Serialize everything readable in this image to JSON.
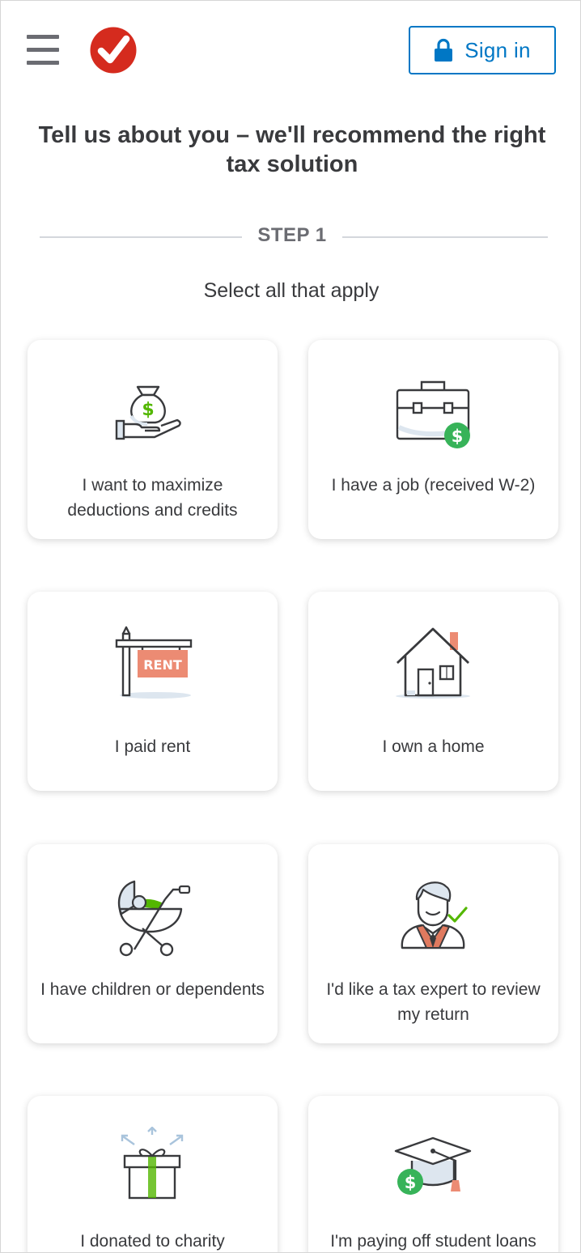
{
  "header": {
    "menu_icon": "hamburger-menu-icon",
    "logo_icon": "checkmark-logo-icon",
    "signin_icon": "lock-icon",
    "signin_label": "Sign in"
  },
  "headline": "Tell us about you – we'll recommend the right tax solution",
  "step_label": "STEP 1",
  "subhead": "Select all that apply",
  "colors": {
    "accent": "#0077c5",
    "logo_red": "#d52b1e",
    "icon_green": "#53b700",
    "rent_sign": "#ec8b73",
    "text": "#393a3d",
    "muted": "#6b6c72"
  },
  "options": [
    {
      "icon": "money-bag-hand-icon",
      "label": "I want to maximize deductions and credits"
    },
    {
      "icon": "briefcase-dollar-icon",
      "label": "I have a job (received W-2)"
    },
    {
      "icon": "rent-sign-icon",
      "rent_text": "RENT",
      "label": "I paid rent"
    },
    {
      "icon": "house-icon",
      "label": "I own a home"
    },
    {
      "icon": "baby-stroller-icon",
      "label": "I have children or dependents"
    },
    {
      "icon": "tax-expert-icon",
      "label": "I'd like a tax expert to review my return"
    },
    {
      "icon": "gift-box-icon",
      "label": "I donated to charity"
    },
    {
      "icon": "graduation-cap-dollar-icon",
      "label": "I'm paying off student loans"
    }
  ]
}
